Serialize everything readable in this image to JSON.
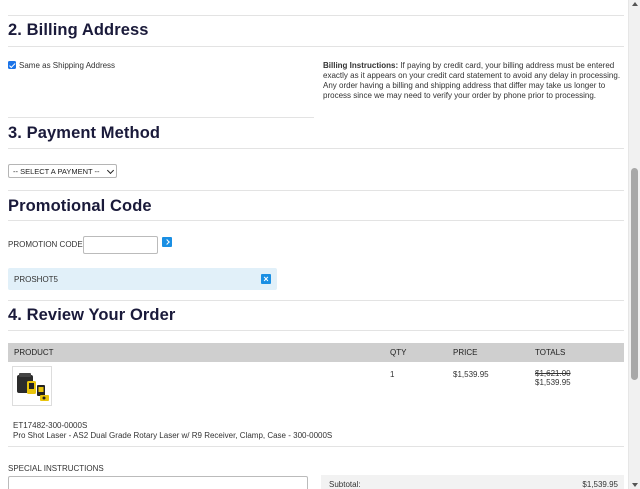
{
  "billing": {
    "heading": "2. Billing Address",
    "same_as_shipping_label": "Same as Shipping Address",
    "instructions_label": "Billing Instructions:",
    "instructions_text": " If paying by credit card, your billing address must be entered exactly as it appears on your credit card statement to avoid any delay in processing. Any order having a billing and shipping address that differ may take us longer to process since we may need to verify your order by phone prior to processing."
  },
  "payment": {
    "heading": "3. Payment Method",
    "select_value": "-- SELECT A PAYMENT --"
  },
  "promo": {
    "heading": "Promotional Code",
    "code_label": "PROMOTION CODE",
    "input_value": "",
    "applied_code": "PROSHOT5"
  },
  "review": {
    "heading": "4. Review Your Order",
    "columns": {
      "product": "PRODUCT",
      "qty": "QTY",
      "price": "PRICE",
      "totals": "TOTALS"
    },
    "items": [
      {
        "sku": "ET17482-300-0000S",
        "name": "Pro Shot Laser - AS2 Dual Grade Rotary Laser w/ R9 Receiver, Clamp, Case - 300-0000S",
        "qty": "1",
        "price": "$1,539.95",
        "original_total": "$1,621.00",
        "total": "$1,539.95"
      }
    ],
    "special_instructions_label": "SPECIAL INSTRUCTIONS",
    "subtotal_label": "Subtotal:",
    "subtotal_value": "$1,539.95"
  },
  "colors": {
    "accent": "#1a8fe3",
    "heading": "#1a1a3a",
    "chip_bg": "#e1f0f9",
    "table_head_bg": "#cfcfcf"
  }
}
